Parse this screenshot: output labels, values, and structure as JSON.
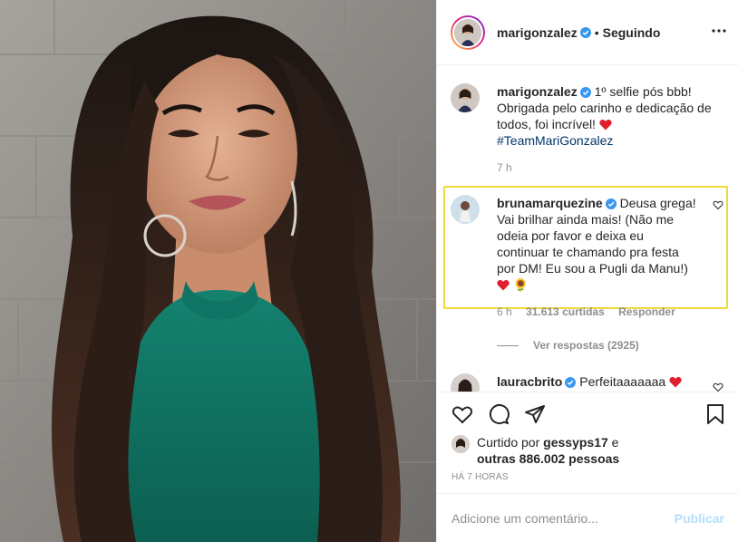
{
  "header": {
    "username": "marigonzalez",
    "separator": "•",
    "follow_status": "Seguindo"
  },
  "caption": {
    "username": "marigonzalez",
    "text": "1º selfie pós bbb! Obrigada pelo carinho e dedicação de todos, foi incrível!",
    "hashtag": "#TeamMariGonzalez",
    "time": "7 h"
  },
  "comments": [
    {
      "username": "brunamarquezine",
      "text": "Deusa grega! Vai brilhar ainda mais! (Não me odeia por favor e deixa eu continuar te chamando pra festa por DM! Eu sou a Pugli da Manu!)",
      "emoji": "🌻",
      "time": "6 h",
      "likes": "31.613 curtidas",
      "reply": "Responder",
      "view_replies": "Ver respostas (2925)"
    },
    {
      "username": "lauracbrito",
      "text": "Perfeitaaaaaaa"
    }
  ],
  "likes": {
    "prefix": "Curtido por",
    "user": "gessyps17",
    "conj": "e",
    "others": "outras 886.002 pessoas"
  },
  "timestamp": "HÁ 7 HORAS",
  "add_comment": {
    "placeholder": "Adicione um comentário...",
    "publish": "Publicar"
  },
  "colors": {
    "highlight_border": "#f0d83a",
    "verified": "#3897f0",
    "heart": "#ed4956",
    "publish_disabled": "#b2dffc"
  }
}
